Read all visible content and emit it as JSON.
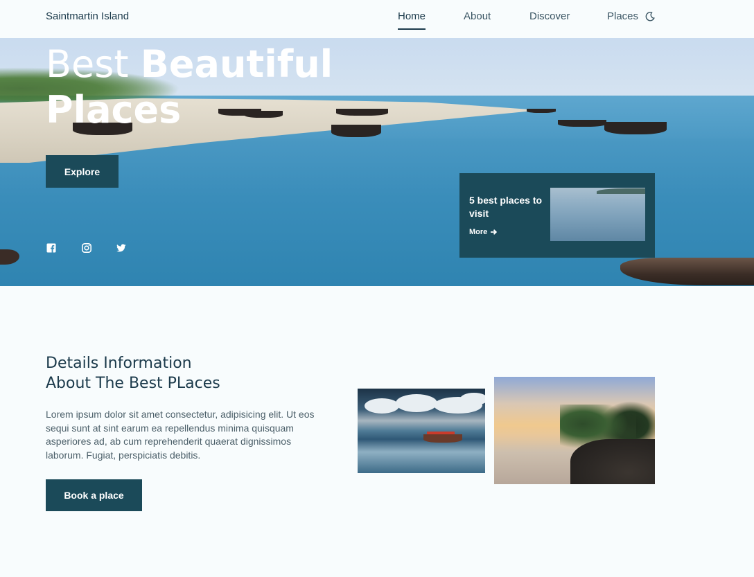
{
  "brand": "Saintmartin Island",
  "nav": {
    "links": [
      "Home",
      "About",
      "Discover",
      "Places"
    ],
    "active": "Home",
    "theme_icon": "moon-icon"
  },
  "hero": {
    "title_light": "Best",
    "title_bold": "Beautiful",
    "title_line2": "Places",
    "explore_label": "Explore",
    "social": [
      "facebook-icon",
      "instagram-icon",
      "twitter-icon"
    ]
  },
  "card": {
    "title": "5 best places to visit",
    "more_label": "More"
  },
  "details": {
    "title_line1": "Details Information",
    "title_line2": "About The Best PLaces",
    "text": "Lorem ipsum dolor sit amet consectetur, adipisicing elit. Ut eos sequi sunt at sint earum ea repellendus minima quisquam asperiores ad, ab cum reprehenderit quaerat dignissimos laborum. Fugiat, perspiciatis debitis.",
    "button_label": "Book a place"
  },
  "colors": {
    "primary": "#1b4a59",
    "text": "#1b3a4b",
    "background": "#f8fcfd"
  }
}
